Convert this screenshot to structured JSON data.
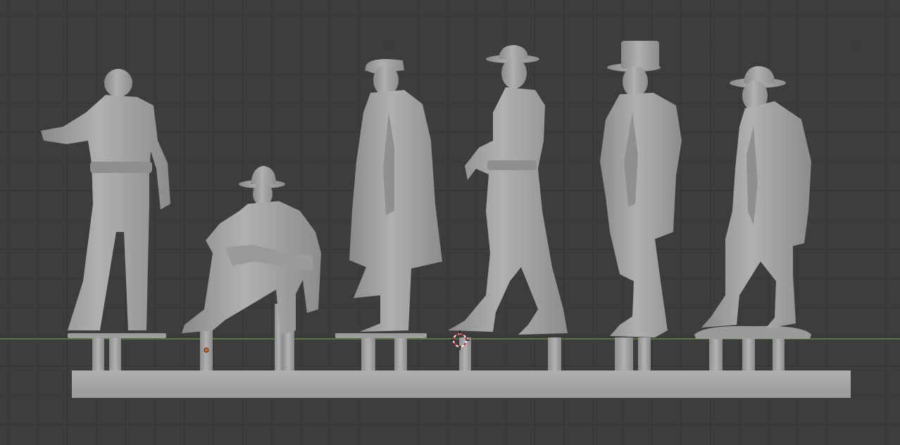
{
  "viewport": {
    "background": "#3d3d3d",
    "grid_line_color": "#353535",
    "floor_axis_color": "#5d8a3a",
    "model_color": "#a6a6a6",
    "model_shadow_color": "#7c7c7c",
    "model_highlight_color": "#c4c4c4",
    "origin_marker_color": "#ff6a00",
    "cursor_colors": [
      "#ffffff",
      "#e02020"
    ]
  },
  "scene": {
    "figures": [
      {
        "name": "figure-rolled-sleeves-back-view",
        "pose": "standing"
      },
      {
        "name": "figure-seated-bowler-hat",
        "pose": "seated"
      },
      {
        "name": "figure-long-coat-cap",
        "pose": "standing"
      },
      {
        "name": "figure-walking-bowler-hat",
        "pose": "walking"
      },
      {
        "name": "figure-top-hat-frock-coat",
        "pose": "standing"
      },
      {
        "name": "figure-bearded-wide-brim-hat",
        "pose": "standing"
      }
    ],
    "icons": {
      "origin": "origin-dot-icon",
      "cursor": "3d-cursor-icon"
    }
  }
}
